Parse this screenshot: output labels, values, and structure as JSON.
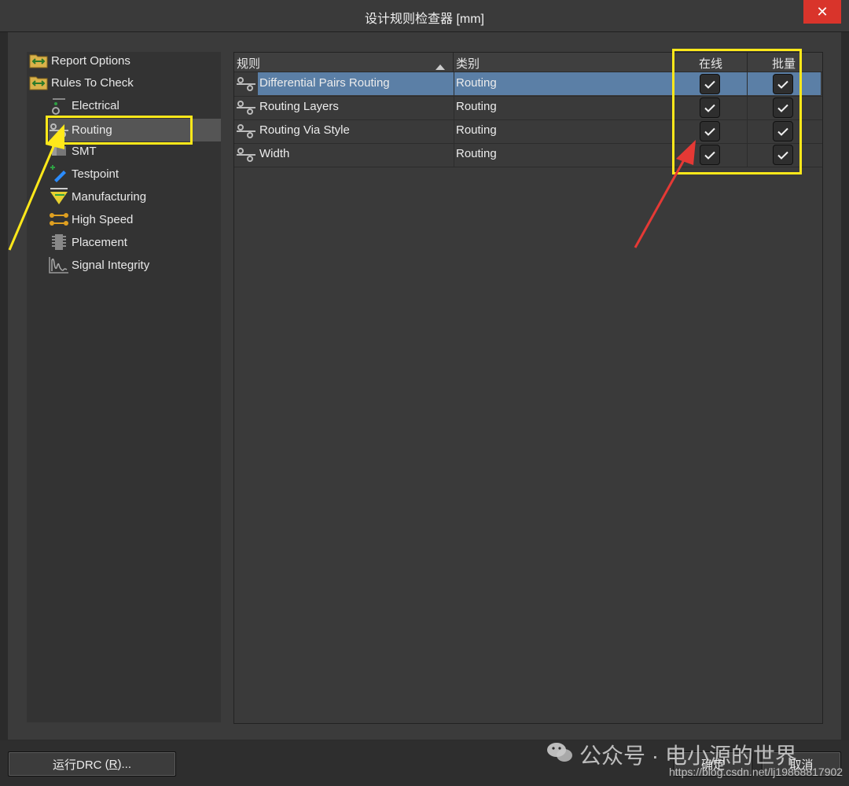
{
  "window": {
    "title": "设计规则检查器 [mm]",
    "close_glyph": "✕"
  },
  "tree": {
    "items": [
      {
        "label": "Report Options",
        "icon": "folder-icon"
      },
      {
        "label": "Rules To Check",
        "icon": "folder-icon"
      },
      {
        "label": "Electrical",
        "icon": "electrical-icon"
      },
      {
        "label": "Routing",
        "icon": "routing-icon"
      },
      {
        "label": "SMT",
        "icon": "smt-icon"
      },
      {
        "label": "Testpoint",
        "icon": "testpoint-icon"
      },
      {
        "label": "Manufacturing",
        "icon": "manufacturing-icon"
      },
      {
        "label": "High Speed",
        "icon": "high-speed-icon"
      },
      {
        "label": "Placement",
        "icon": "placement-icon"
      },
      {
        "label": "Signal Integrity",
        "icon": "signal-integrity-icon"
      }
    ]
  },
  "grid": {
    "headers": {
      "rule": "规则",
      "category": "类别",
      "online": "在线",
      "batch": "批量"
    },
    "rows": [
      {
        "rule": "Differential Pairs Routing",
        "category": "Routing",
        "online": true,
        "batch": true,
        "selected": true
      },
      {
        "rule": "Routing Layers",
        "category": "Routing",
        "online": true,
        "batch": true,
        "selected": false
      },
      {
        "rule": "Routing Via Style",
        "category": "Routing",
        "online": true,
        "batch": true,
        "selected": false
      },
      {
        "rule": "Width",
        "category": "Routing",
        "online": true,
        "batch": true,
        "selected": false
      }
    ]
  },
  "footer": {
    "run_drc_label": "运行DRC",
    "run_drc_key": "R",
    "ok_label": "确定",
    "cancel_label": "取消"
  },
  "watermark": {
    "text": "公众号 · 电小源的世界",
    "url": "https://blog.csdn.net/lj19868817902"
  },
  "colors": {
    "accent": "#5b7fa6",
    "highlight_yellow": "#ffe81a",
    "arrow_red": "#e53935",
    "close_red": "#d9342b"
  }
}
